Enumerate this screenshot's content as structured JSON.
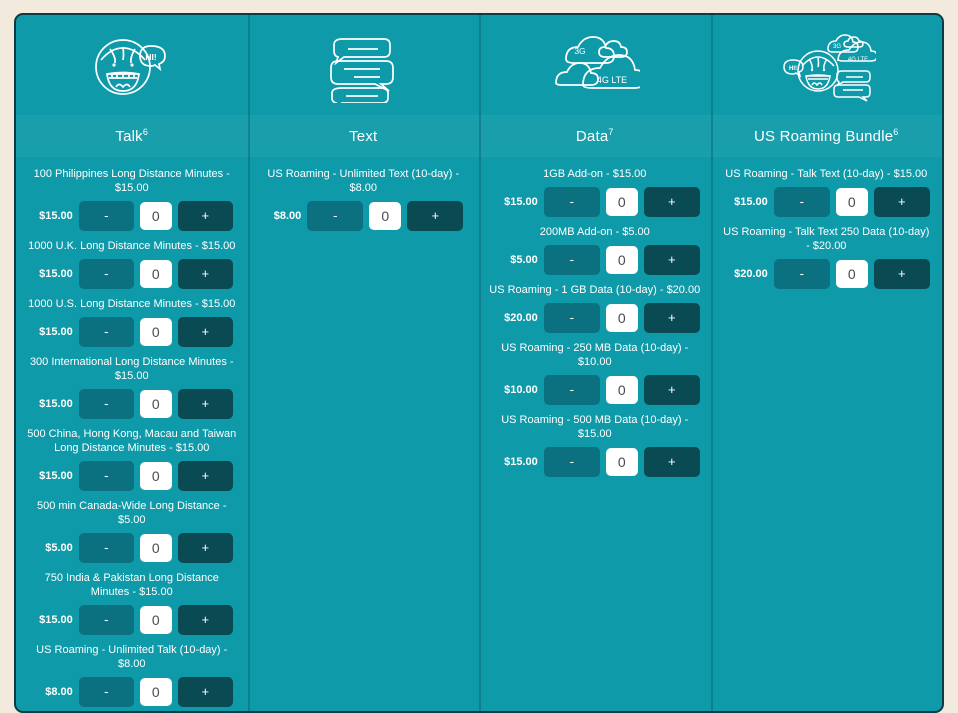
{
  "theme": {
    "page_background": "#f2eadc",
    "panel_background": "#0f9aa9",
    "panel_border": "#0c3b45",
    "minus_button": "#0b7080",
    "plus_button": "#0a4a53",
    "qty_background": "#ffffff",
    "text_color": "#ffffff"
  },
  "columns": [
    {
      "id": "talk",
      "title": "Talk",
      "title_superscript": "6",
      "icon": "talking-face-icon",
      "items": [
        {
          "label": "100 Philippines Long Distance Minutes - $15.00",
          "price": "$15.00",
          "qty": "0",
          "minus": "-",
          "plus": "+"
        },
        {
          "label": "1000 U.K. Long Distance Minutes - $15.00",
          "price": "$15.00",
          "qty": "0",
          "minus": "-",
          "plus": "+"
        },
        {
          "label": "1000 U.S. Long Distance Minutes - $15.00",
          "price": "$15.00",
          "qty": "0",
          "minus": "-",
          "plus": "+"
        },
        {
          "label": "300 International Long Distance Minutes - $15.00",
          "price": "$15.00",
          "qty": "0",
          "minus": "-",
          "plus": "+"
        },
        {
          "label": "500 China, Hong Kong, Macau and Taiwan Long Distance Minutes - $15.00",
          "price": "$15.00",
          "qty": "0",
          "minus": "-",
          "plus": "+"
        },
        {
          "label": "500 min Canada-Wide Long Distance - $5.00",
          "price": "$5.00",
          "qty": "0",
          "minus": "-",
          "plus": "+"
        },
        {
          "label": "750 India & Pakistan Long Distance Minutes - $15.00",
          "price": "$15.00",
          "qty": "0",
          "minus": "-",
          "plus": "+"
        },
        {
          "label": "US Roaming - Unlimited Talk (10-day) - $8.00",
          "price": "$8.00",
          "qty": "0",
          "minus": "-",
          "plus": "+"
        }
      ]
    },
    {
      "id": "text",
      "title": "Text",
      "title_superscript": "",
      "icon": "chat-bubbles-icon",
      "items": [
        {
          "label": "US Roaming - Unlimited Text (10-day) - $8.00",
          "price": "$8.00",
          "qty": "0",
          "minus": "-",
          "plus": "+"
        }
      ]
    },
    {
      "id": "data",
      "title": "Data",
      "title_superscript": "7",
      "icon": "data-clouds-icon",
      "icon_labels": [
        "3G",
        "4G LTE"
      ],
      "items": [
        {
          "label": "1GB Add-on - $15.00",
          "price": "$15.00",
          "qty": "0",
          "minus": "-",
          "plus": "+"
        },
        {
          "label": "200MB Add-on - $5.00",
          "price": "$5.00",
          "qty": "0",
          "minus": "-",
          "plus": "+"
        },
        {
          "label": "US Roaming - 1 GB Data (10-day) - $20.00",
          "price": "$20.00",
          "qty": "0",
          "minus": "-",
          "plus": "+"
        },
        {
          "label": "US Roaming - 250 MB Data (10-day) - $10.00",
          "price": "$10.00",
          "qty": "0",
          "minus": "-",
          "plus": "+"
        },
        {
          "label": "US Roaming - 500 MB Data (10-day) - $15.00",
          "price": "$15.00",
          "qty": "0",
          "minus": "-",
          "plus": "+"
        }
      ]
    },
    {
      "id": "bundle",
      "title": "US Roaming Bundle",
      "title_superscript": "6",
      "icon": "roaming-bundle-icon",
      "items": [
        {
          "label": "US Roaming - Talk Text (10-day) - $15.00",
          "price": "$15.00",
          "qty": "0",
          "minus": "-",
          "plus": "+"
        },
        {
          "label": "US Roaming - Talk Text 250 Data (10-day) - $20.00",
          "price": "$20.00",
          "qty": "0",
          "minus": "-",
          "plus": "+"
        }
      ]
    }
  ]
}
